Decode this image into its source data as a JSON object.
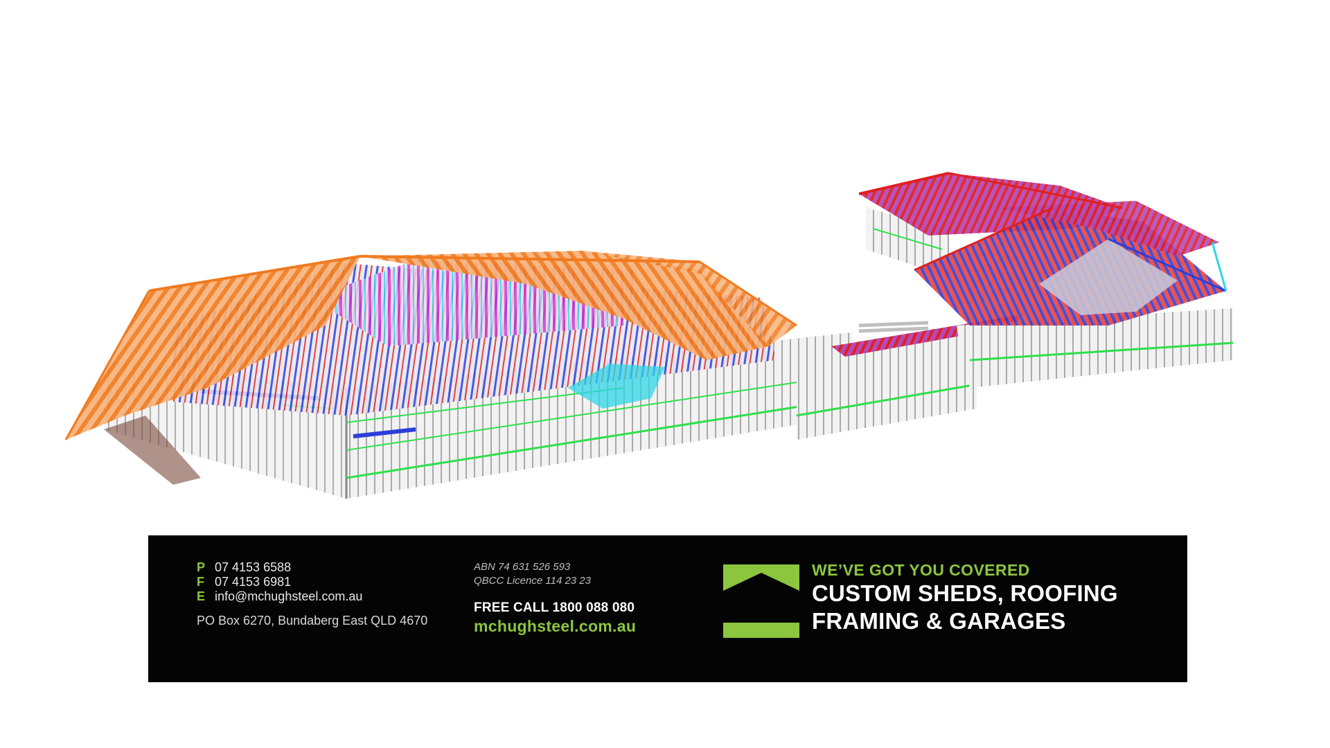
{
  "contact": {
    "phone_key": "P",
    "phone": "07 4153 6588",
    "fax_key": "F",
    "fax": "07 4153 6981",
    "email_key": "E",
    "email": "info@mchughsteel.com.au",
    "address": "PO Box 6270, Bundaberg East QLD 4670"
  },
  "legal": {
    "abn": "ABN 74 631 526 593",
    "qbcc": "QBCC Licence 114 23 23"
  },
  "call": {
    "free_call": "FREE CALL 1800 088 080",
    "website": "mchughsteel.com.au"
  },
  "brand": {
    "tagline": "WE’VE GOT YOU COVERED",
    "headline_line1": "CUSTOM SHEDS, ROOFING",
    "headline_line2": "FRAMING & GARAGES"
  },
  "colors": {
    "brand_green": "#8cc63f",
    "banner_black": "#040404",
    "roof_orange": "#f07a1e",
    "truss_red": "#e02020",
    "web_blue": "#2d3ed8",
    "web_magenta": "#cc33cc",
    "web_cyan": "#2fd6e6",
    "wall_grey": "#a9a9a9",
    "nogging_green": "#2ee04a"
  },
  "icons": {
    "logo": "house-roof-logo-icon"
  }
}
